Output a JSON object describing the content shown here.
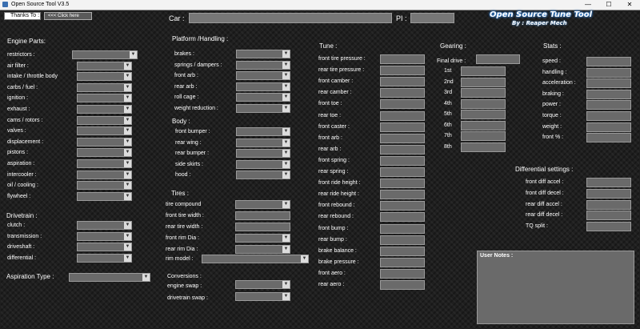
{
  "window": {
    "title": "Open Source Tool V3.5",
    "minimize": "—",
    "maximize": "☐",
    "close": "✕"
  },
  "header": {
    "thanks_label": "Thanks To :",
    "click_label": "<<< Click here",
    "car_label": "Car :",
    "pi_label": "PI :",
    "logo_title": "Open Source Tune Tool",
    "logo_byline": "By : Reaper Mech"
  },
  "engine": {
    "title": "Engine Parts:",
    "items": [
      "restrictors :",
      "air filter :",
      "intake / throttle body",
      "carbs / fuel :",
      "ignition :",
      "exhaust :",
      "cams / rotors :",
      "valves :",
      "displacement :",
      "pistons :",
      "aspiration :",
      "intercooler :",
      "oil / cooling :",
      "flywheel :"
    ]
  },
  "drivetrain": {
    "title": "Drivetrain :",
    "items": [
      "clutch :",
      "transmission :",
      "driveshaft :",
      "differential :"
    ]
  },
  "aspiration_type": {
    "label": "Aspiration Type :"
  },
  "platform": {
    "title": "Platform /Handling :",
    "items": [
      "brakes :",
      "springs / dampers :",
      "front arb :",
      "rear arb :",
      "roll cage :",
      "weight reduction :"
    ]
  },
  "body": {
    "title": "Body :",
    "items": [
      "front bumper :",
      "rear wing :",
      "rear bumper :",
      "side skirts :",
      "hood :"
    ]
  },
  "tires": {
    "title": "Tires :",
    "compound": "tire compound",
    "front_width": "front tire width :",
    "rear_width": "rear tire width :",
    "front_rim": "front rim Dia :",
    "rear_rim": "rear rim Dia :",
    "rim_model": "rim model :"
  },
  "conversions": {
    "title": "Conversions :",
    "engine_swap": "engine swap :",
    "drivetrain_swap": "drivetrain swap :"
  },
  "tune": {
    "title": "Tune :",
    "items": [
      "front tire pressure :",
      "rear tire pressure :",
      "front camber :",
      "rear camber :",
      "front toe :",
      "rear toe :",
      "front caster :",
      "front arb :",
      "rear arb :",
      "front spring :",
      "rear spring :",
      "front ride height :",
      "rear ride height :",
      "front rebound :",
      "rear rebound :",
      "front bump :",
      "rear bump :",
      "brake balance :",
      "brake pressure :",
      "front aero :",
      "rear aero :"
    ]
  },
  "gearing": {
    "title": "Gearing :",
    "final_drive": "Final drive :",
    "gears": [
      "1st",
      "2nd",
      "3rd",
      "4th",
      "5th",
      "6th",
      "7th",
      "8th"
    ]
  },
  "stats": {
    "title": "Stats :",
    "items": [
      "speed :",
      "handling :",
      "acceleration :",
      "braking :",
      "power :",
      "torque :",
      "weight :",
      "front % :"
    ]
  },
  "differential": {
    "title": "Differential settings :",
    "items": [
      "front diff accel :",
      "front diff decel :",
      "rear diff accel :",
      "rear diff decel :",
      "TQ split :"
    ]
  },
  "notes": {
    "label": "User Notes :"
  }
}
